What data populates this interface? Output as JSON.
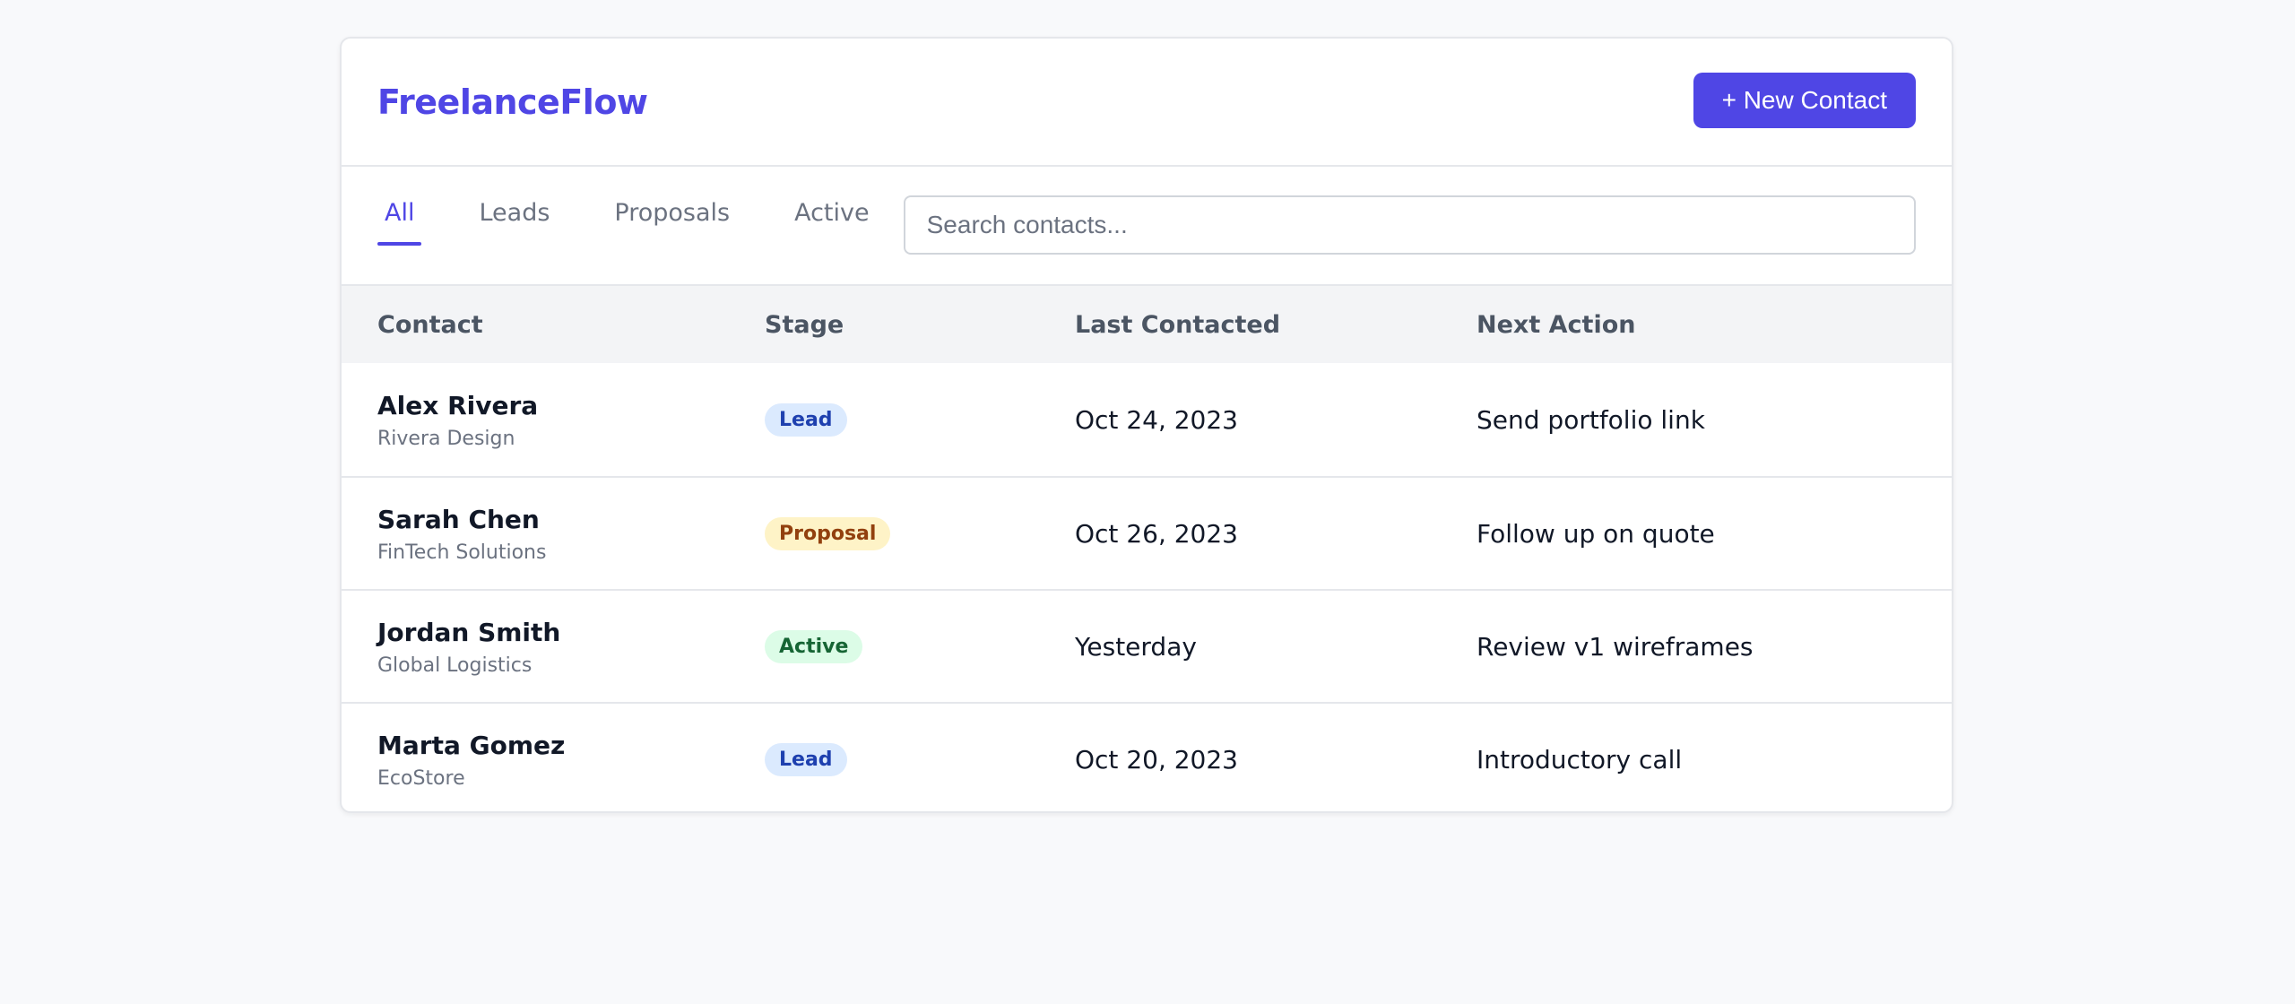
{
  "header": {
    "brand": "FreelanceFlow",
    "new_contact_label": "+ New Contact"
  },
  "tabs": [
    {
      "label": "All",
      "active": true
    },
    {
      "label": "Leads",
      "active": false
    },
    {
      "label": "Proposals",
      "active": false
    },
    {
      "label": "Active",
      "active": false
    }
  ],
  "search": {
    "placeholder": "Search contacts...",
    "value": ""
  },
  "table": {
    "columns": [
      "Contact",
      "Stage",
      "Last Contacted",
      "Next Action"
    ],
    "rows": [
      {
        "name": "Alex Rivera",
        "company": "Rivera Design",
        "stage": "Lead",
        "last_contacted": "Oct 24, 2023",
        "next_action": "Send portfolio link"
      },
      {
        "name": "Sarah Chen",
        "company": "FinTech Solutions",
        "stage": "Proposal",
        "last_contacted": "Oct 26, 2023",
        "next_action": "Follow up on quote"
      },
      {
        "name": "Jordan Smith",
        "company": "Global Logistics",
        "stage": "Active",
        "last_contacted": "Yesterday",
        "next_action": "Review v1 wireframes"
      },
      {
        "name": "Marta Gomez",
        "company": "EcoStore",
        "stage": "Lead",
        "last_contacted": "Oct 20, 2023",
        "next_action": "Introductory call"
      }
    ]
  },
  "colors": {
    "accent": "#4f46e5",
    "lead_bg": "#dbeafe",
    "proposal_bg": "#fef3c7",
    "active_bg": "#dcfce7"
  }
}
